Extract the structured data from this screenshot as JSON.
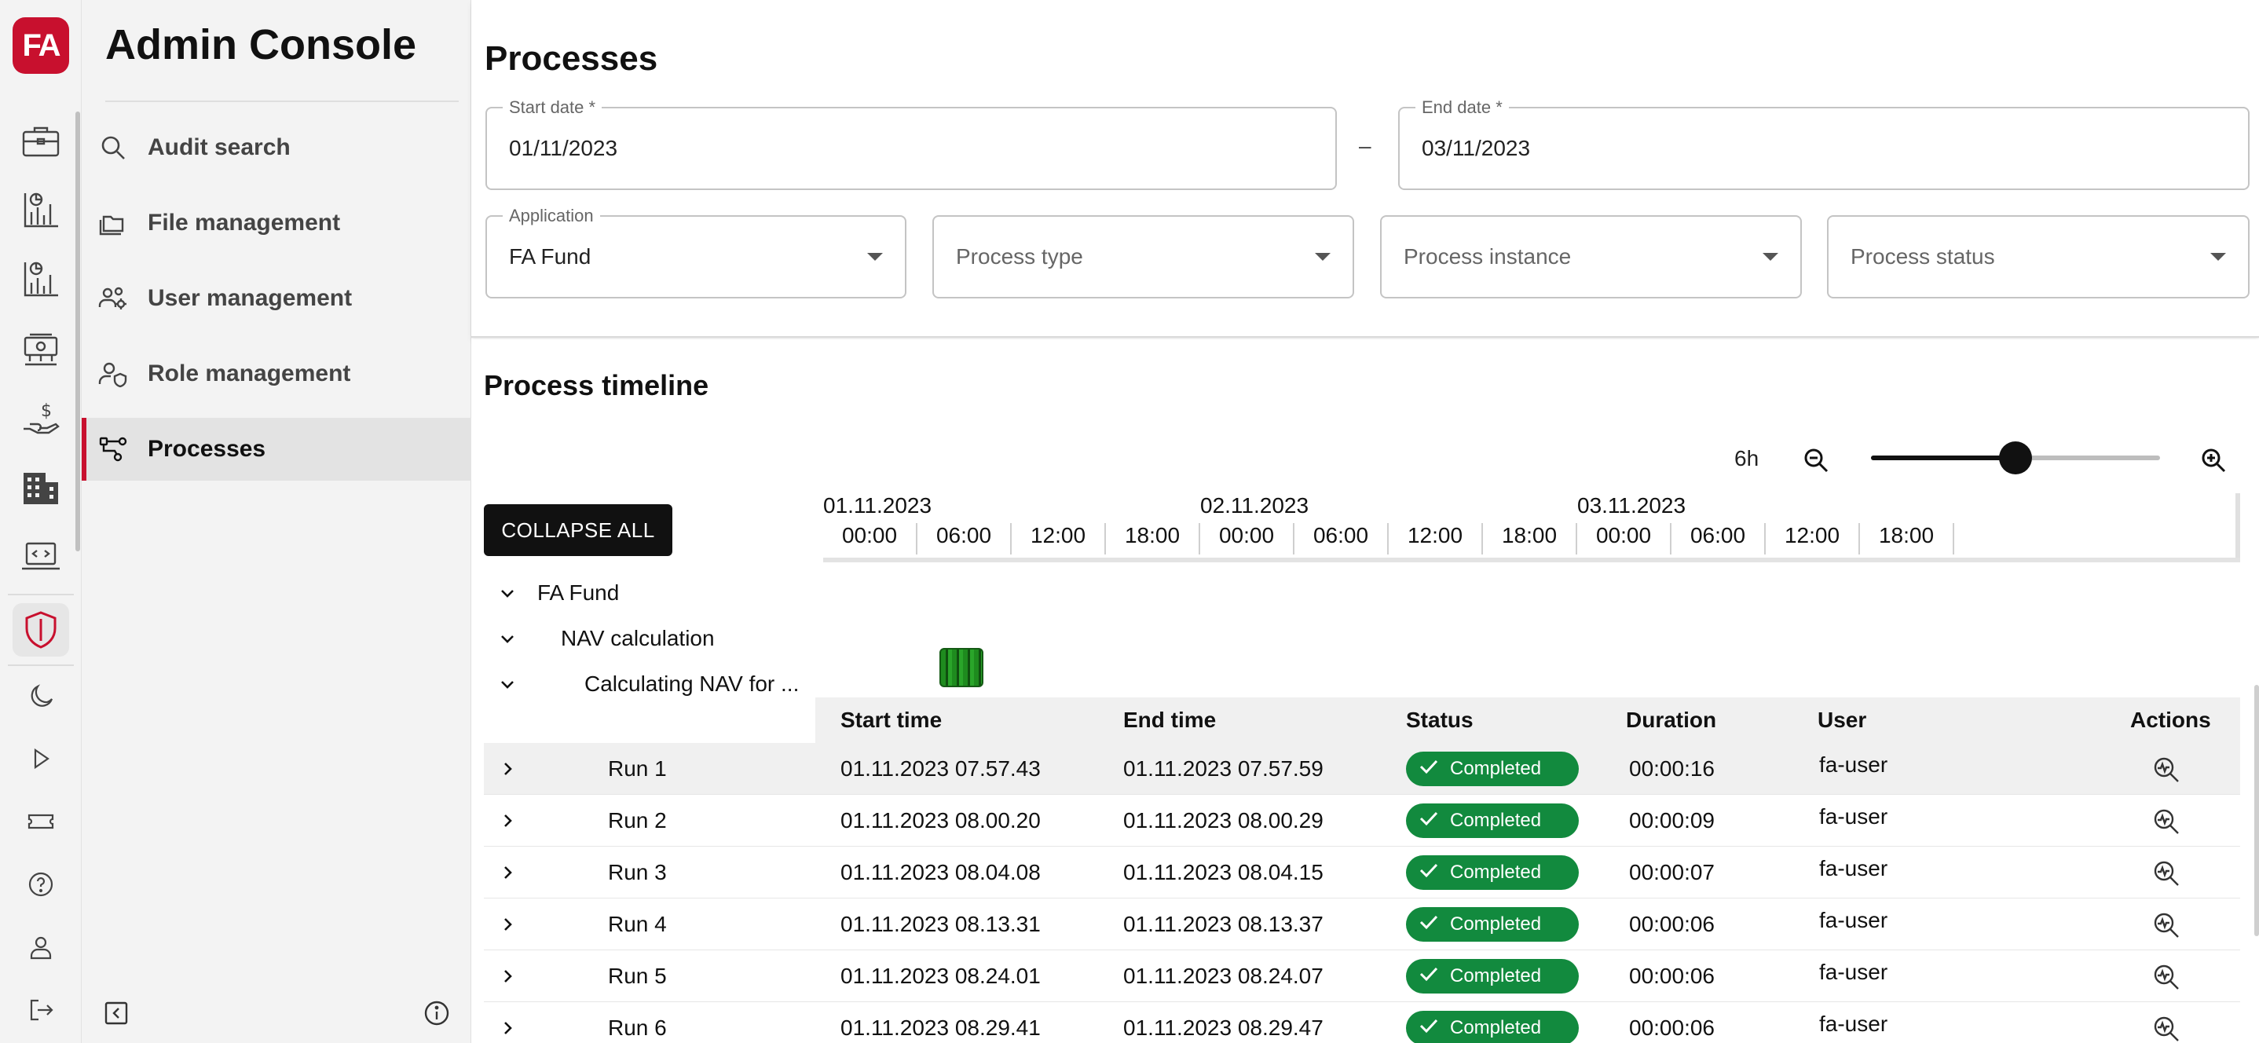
{
  "app": {
    "logo_text": "FA",
    "title": "Admin Console"
  },
  "rail": {
    "items": [
      {
        "icon": "briefcase-icon"
      },
      {
        "icon": "chart-report-icon"
      },
      {
        "icon": "chart-analytics-icon"
      },
      {
        "icon": "money-network-icon"
      },
      {
        "icon": "hand-dollar-icon"
      },
      {
        "icon": "building-icon"
      },
      {
        "icon": "laptop-code-icon"
      },
      {
        "icon": "shield-icon",
        "active": true
      },
      {
        "icon": "moon-icon"
      },
      {
        "icon": "play-icon"
      },
      {
        "icon": "ticket-icon"
      },
      {
        "icon": "help-icon"
      },
      {
        "icon": "user-icon"
      },
      {
        "icon": "logout-icon"
      }
    ]
  },
  "sidebar": {
    "items": [
      {
        "label": "Audit search",
        "icon": "search-icon"
      },
      {
        "label": "File management",
        "icon": "folders-icon"
      },
      {
        "label": "User management",
        "icon": "users-gear-icon"
      },
      {
        "label": "Role management",
        "icon": "user-shield-icon"
      },
      {
        "label": "Processes",
        "icon": "process-tree-icon",
        "active": true
      }
    ],
    "bottom": {
      "collapse_icon": "collapse-sidebar-icon",
      "info_icon": "info-icon"
    }
  },
  "page": {
    "title": "Processes",
    "start_date": {
      "label": "Start date *",
      "value": "01/11/2023"
    },
    "date_separator": "–",
    "end_date": {
      "label": "End date *",
      "value": "03/11/2023"
    },
    "application": {
      "label": "Application",
      "value": "FA Fund"
    },
    "process_type": {
      "placeholder": "Process type"
    },
    "process_instance": {
      "placeholder": "Process instance"
    },
    "process_status": {
      "placeholder": "Process status"
    }
  },
  "timeline": {
    "title": "Process timeline",
    "zoom_label": "6h",
    "zoom_level": 0.5,
    "collapse_all": "COLLAPSE ALL",
    "dates": [
      "01.11.2023",
      "02.11.2023",
      "03.11.2023"
    ],
    "times": [
      "00:00",
      "06:00",
      "12:00",
      "18:00",
      "00:00",
      "06:00",
      "12:00",
      "18:00",
      "00:00",
      "06:00",
      "12:00",
      "18:00"
    ],
    "tree": {
      "application": "FA Fund",
      "process_type": "NAV calculation",
      "process_instance": "Calculating NAV for ..."
    },
    "bar_color": "#1e8b1e"
  },
  "runs": {
    "columns": {
      "start": "Start time",
      "end": "End time",
      "status": "Status",
      "duration": "Duration",
      "user": "User",
      "actions": "Actions"
    },
    "status_color": "#128a3e",
    "rows": [
      {
        "name": "Run 1",
        "start": "01.11.2023 07.57.43",
        "end": "01.11.2023 07.57.59",
        "status": "Completed",
        "duration": "00:00:16",
        "user": "fa-user"
      },
      {
        "name": "Run 2",
        "start": "01.11.2023 08.00.20",
        "end": "01.11.2023 08.00.29",
        "status": "Completed",
        "duration": "00:00:09",
        "user": "fa-user"
      },
      {
        "name": "Run 3",
        "start": "01.11.2023 08.04.08",
        "end": "01.11.2023 08.04.15",
        "status": "Completed",
        "duration": "00:00:07",
        "user": "fa-user"
      },
      {
        "name": "Run 4",
        "start": "01.11.2023 08.13.31",
        "end": "01.11.2023 08.13.37",
        "status": "Completed",
        "duration": "00:00:06",
        "user": "fa-user"
      },
      {
        "name": "Run 5",
        "start": "01.11.2023 08.24.01",
        "end": "01.11.2023 08.24.07",
        "status": "Completed",
        "duration": "00:00:06",
        "user": "fa-user"
      },
      {
        "name": "Run 6",
        "start": "01.11.2023 08.29.41",
        "end": "01.11.2023 08.29.47",
        "status": "Completed",
        "duration": "00:00:06",
        "user": "fa-user"
      }
    ]
  }
}
